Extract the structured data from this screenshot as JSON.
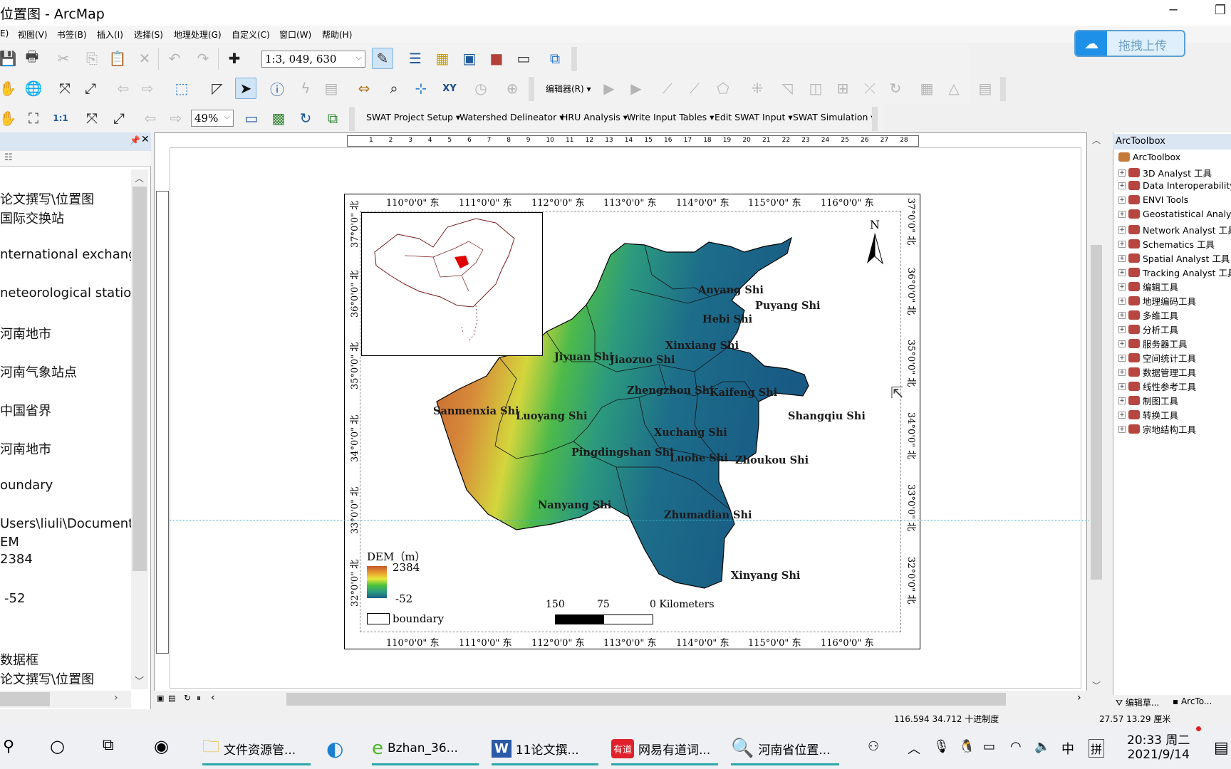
{
  "window": {
    "title": "位置图 - ArcMap",
    "minimize": "─",
    "restore": "❐"
  },
  "menu": [
    "E)",
    "视图(V)",
    "书签(B)",
    "插入(I)",
    "选择(S)",
    "地理处理(G)",
    "自定义(C)",
    "窗口(W)",
    "帮助(H)"
  ],
  "toolbar": {
    "scale_value": "1:3, 049, 630",
    "zoom_value": "49%",
    "editor_label": "编辑器(R)",
    "swat_menus": [
      "SWAT Project Setup",
      "Watershed Delineator",
      "HRU Analysis",
      "Write Input Tables",
      "Edit SWAT Input",
      "SWAT Simulation"
    ]
  },
  "upload_button": {
    "label": "拖拽上传",
    "icon": "cloud-icon",
    "accent": "#1e90e8"
  },
  "toc": {
    "items": [
      "论文撰写\\位置图",
      "国际交换站",
      "nternational exchange",
      "neteorological station",
      "河南地市",
      "河南气象站点",
      "中国省界",
      "河南地市",
      "oundary",
      "Users\\liuli\\Documents\\",
      "EM",
      "2384",
      "-52",
      "数据框",
      "论文撰写\\位置图"
    ]
  },
  "ruler": {
    "ticks": [
      "1",
      "2",
      "3",
      "4",
      "5",
      "6",
      "7",
      "8",
      "9",
      "10",
      "11",
      "12",
      "13",
      "14",
      "15",
      "16",
      "17",
      "18",
      "19",
      "20",
      "21",
      "22",
      "23",
      "24",
      "25",
      "26",
      "27",
      "28"
    ]
  },
  "map": {
    "lon_labels": [
      "110°0'0\" 东",
      "111°0'0\" 东",
      "112°0'0\" 东",
      "113°0'0\" 东",
      "114°0'0\" 东",
      "115°0'0\" 东",
      "116°0'0\" 东"
    ],
    "lat_labels": [
      "37°0'0\" 北",
      "36°0'0\" 北",
      "35°0'0\" 北",
      "34°0'0\" 北",
      "33°0'0\" 北",
      "32°0'0\" 北"
    ],
    "cities": [
      {
        "name": "Anyang Shi"
      },
      {
        "name": "Puyang Shi"
      },
      {
        "name": "Hebi Shi"
      },
      {
        "name": "Xinxiang Shi"
      },
      {
        "name": "Jiyuan Shi"
      },
      {
        "name": "Jiaozuo Shi"
      },
      {
        "name": "Zhengzhou Shi"
      },
      {
        "name": "Kaifeng Shi"
      },
      {
        "name": "Sanmenxia Shi"
      },
      {
        "name": "Luoyang Shi"
      },
      {
        "name": "Shangqiu Shi"
      },
      {
        "name": "Xuchang Shi"
      },
      {
        "name": "Pingdingshan Shi"
      },
      {
        "name": "Luohe Shi"
      },
      {
        "name": "Zhoukou Shi"
      },
      {
        "name": "Nanyang Shi"
      },
      {
        "name": "Zhumadian Shi"
      },
      {
        "name": "Xinyang Shi"
      }
    ],
    "north_label": "N",
    "legend": {
      "title": "DEM（m）",
      "max": "2384",
      "min": "-52",
      "boundary_label": "boundary"
    },
    "scale_bar": {
      "labels": [
        "150",
        "75",
        "0 Kilometers"
      ]
    },
    "highlight_color": "#e00000"
  },
  "toolbox": {
    "header": "ArcToolbox",
    "root": "ArcToolbox",
    "items": [
      "3D Analyst 工具",
      "Data Interoperability",
      "ENVI Tools",
      "Geostatistical Analyst",
      "Network Analyst 工具",
      "Schematics 工具",
      "Spatial Analyst 工具",
      "Tracking Analyst 工具",
      "编辑工具",
      "地理编码工具",
      "多维工具",
      "分析工具",
      "服务器工具",
      "空间统计工具",
      "数据管理工具",
      "线性参考工具",
      "制图工具",
      "转换工具",
      "宗地结构工具"
    ],
    "tabs": [
      "编辑草...",
      "ArcTo..."
    ]
  },
  "status": {
    "coords": "116.594  34.712 十进制度",
    "page_coords": "27.57  13.29 厘米"
  },
  "taskbar": {
    "apps": [
      {
        "label": "文件资源管...",
        "icon": "folder-icon"
      },
      {
        "label": "",
        "icon": "edge-icon"
      },
      {
        "label": "Bzhan_36...",
        "icon": "ie-icon"
      },
      {
        "label": "11论文撰...",
        "icon": "word-icon"
      },
      {
        "label": "网易有道词...",
        "icon": "youdao-icon"
      },
      {
        "label": "河南省位置...",
        "icon": "arcmap-icon"
      }
    ],
    "ime_lang": "中",
    "ime_mode": "拼",
    "time": "20:33 周二",
    "date": "2021/9/14"
  }
}
